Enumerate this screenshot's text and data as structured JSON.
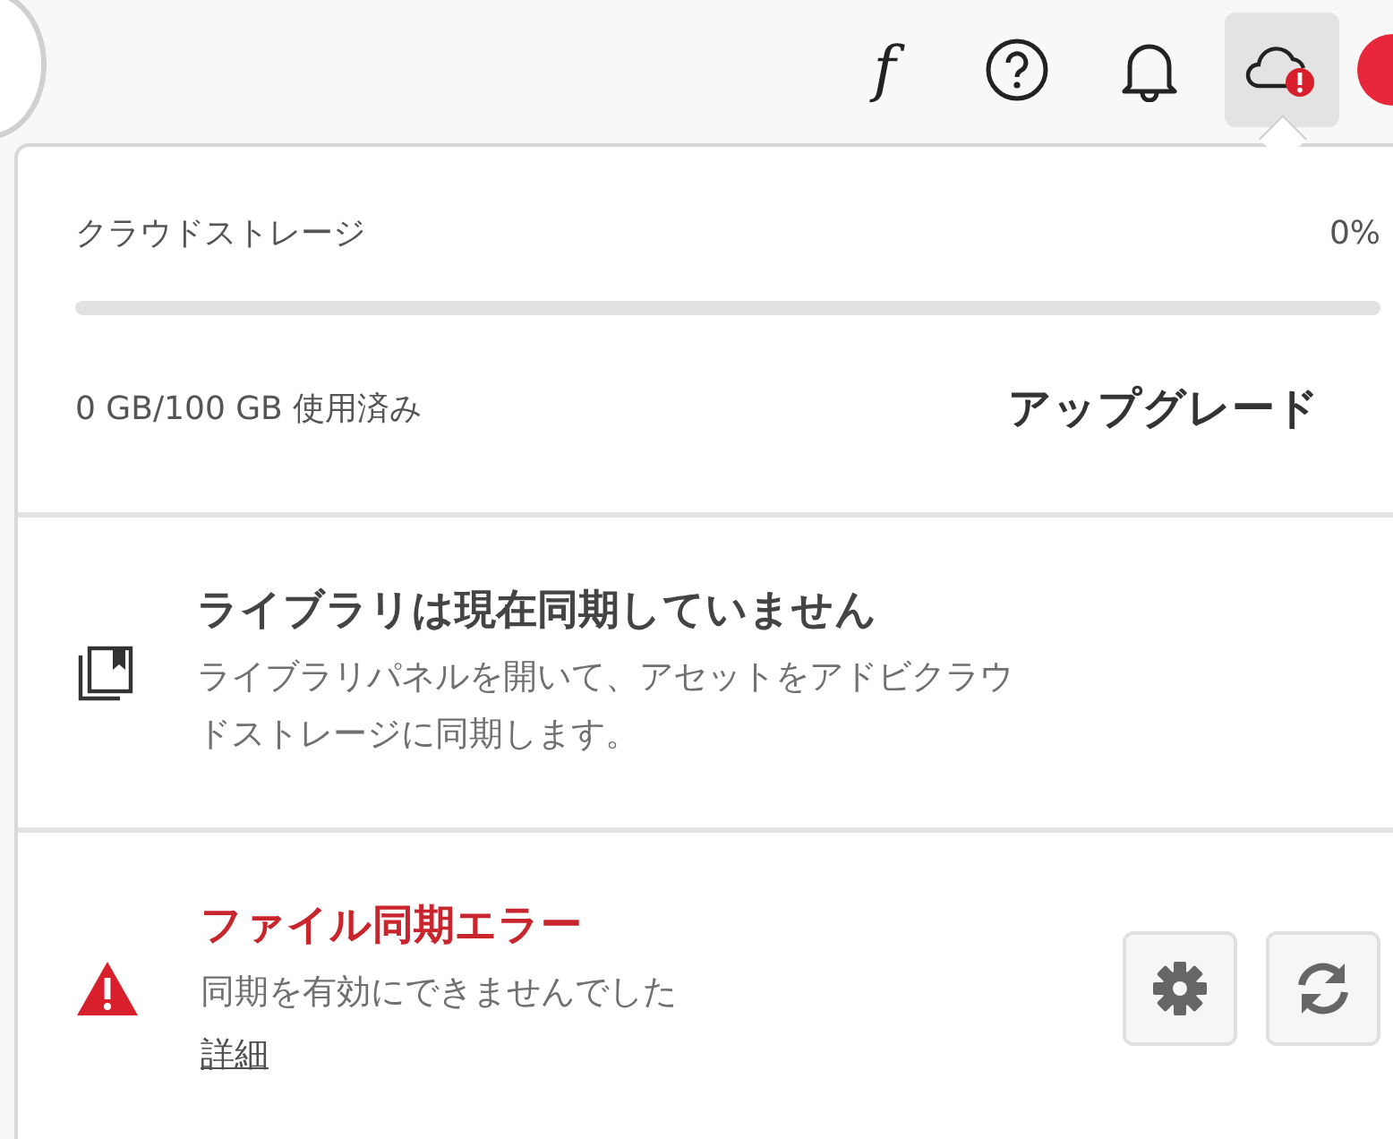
{
  "toolbar": [
    {
      "kind": "font",
      "glyph": "f",
      "selected": false
    },
    {
      "kind": "help",
      "selected": false
    },
    {
      "kind": "notifications",
      "selected": false
    },
    {
      "kind": "cloud",
      "selected": true,
      "error": true
    },
    {
      "kind": "avatar"
    }
  ],
  "storage": {
    "label": "クラウドストレージ",
    "percent": "0%",
    "level": 0,
    "usage": "0 GB/100 GB 使用済み",
    "upgrade": "アップグレード"
  },
  "library": {
    "title": "ライブラリは現在同期していません",
    "description": "ライブラリパネルを開いて、アセットをアドビクラウドストレージに同期します。"
  },
  "sync_error": {
    "title": "ファイル同期エラー",
    "description": "同期を有効にできませんでした",
    "link": "詳細",
    "buttons": [
      {
        "kind": "settings"
      },
      {
        "kind": "refresh"
      }
    ]
  }
}
